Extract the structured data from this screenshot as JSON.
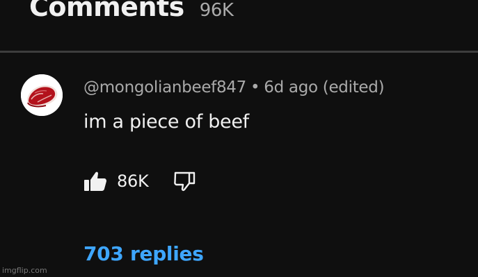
{
  "header": {
    "title": "Comments",
    "count": "96K"
  },
  "comment": {
    "author": "@mongolianbeef847",
    "separator": "•",
    "timestamp": "6d ago (edited)",
    "text": "im a piece of beef",
    "like_count": "86K",
    "replies_label": "703 replies"
  },
  "icons": {
    "like": "thumbs-up-icon",
    "dislike": "thumbs-down-icon",
    "avatar": "beef-steak-avatar"
  },
  "colors": {
    "background": "#0f0f0f",
    "primary_text": "#f1f1f1",
    "secondary_text": "#aaaaaa",
    "link": "#3ea6ff"
  },
  "watermark": "imgflip.com"
}
